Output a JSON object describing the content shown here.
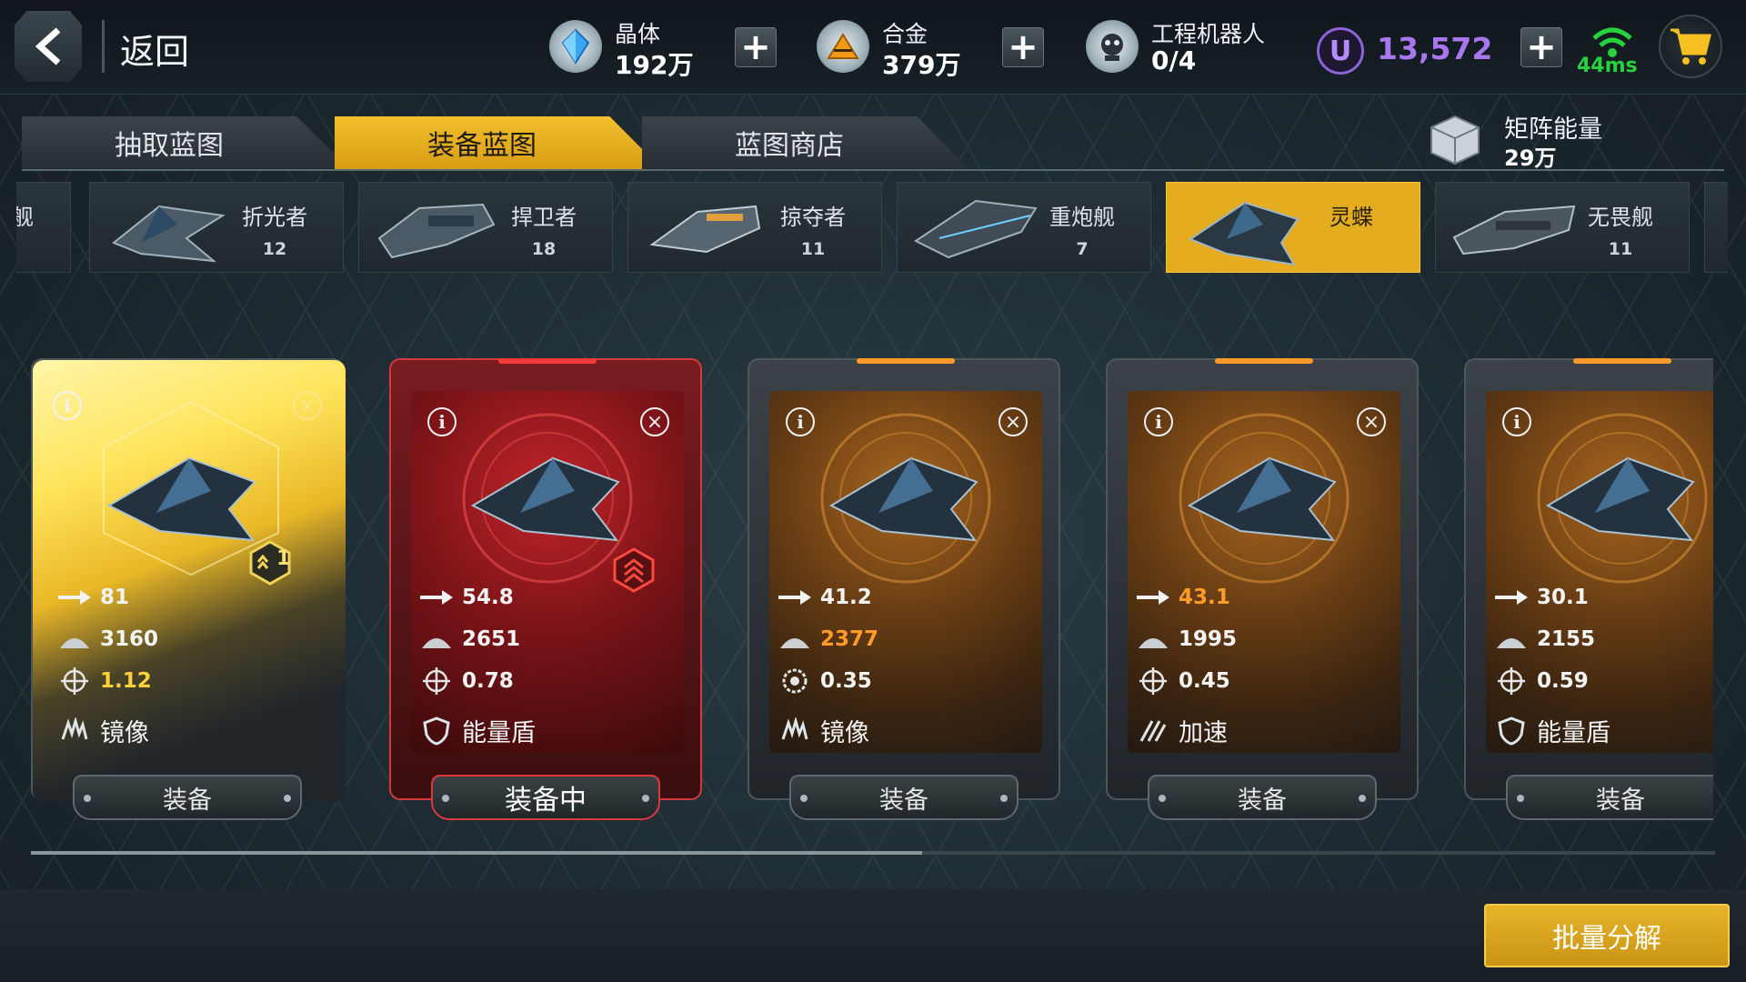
{
  "topbar": {
    "back_label": "返回",
    "resources": [
      {
        "name": "晶体",
        "value": "192万",
        "icon": "crystal-icon"
      },
      {
        "name": "合金",
        "value": "379万",
        "icon": "alloy-icon"
      },
      {
        "name": "工程机器人",
        "value": "0/4",
        "icon": "robot-icon"
      }
    ],
    "currency": {
      "icon_letter": "U",
      "value": "13,572"
    },
    "ping": "44ms"
  },
  "tabs": [
    {
      "label": "抽取蓝图",
      "active": false
    },
    {
      "label": "装备蓝图",
      "active": true
    },
    {
      "label": "蓝图商店",
      "active": false
    }
  ],
  "matrix_energy": {
    "label": "矩阵能量",
    "value": "29万"
  },
  "ships": [
    {
      "name": "舰",
      "count": ""
    },
    {
      "name": "折光者",
      "count": "12"
    },
    {
      "name": "捍卫者",
      "count": "18"
    },
    {
      "name": "掠夺者",
      "count": "11"
    },
    {
      "name": "重炮舰",
      "count": "7"
    },
    {
      "name": "灵蝶",
      "count": "",
      "active": true
    },
    {
      "name": "无畏舰",
      "count": "11"
    }
  ],
  "cards": [
    {
      "style": "yellow",
      "rank": "1",
      "speed": "81",
      "hp": "3160",
      "rate": "1.12",
      "skill": "镜像",
      "button": "装备"
    },
    {
      "style": "red",
      "rank": "",
      "speed": "54.8",
      "hp": "2651",
      "rate": "0.78",
      "skill": "能量盾",
      "button": "装备中"
    },
    {
      "style": "gold",
      "rank": "",
      "speed": "41.2",
      "hp": "2377",
      "rate": "0.35",
      "skill": "镜像",
      "button": "装备"
    },
    {
      "style": "gold",
      "rank": "",
      "speed": "43.1",
      "hp": "1995",
      "rate": "0.45",
      "skill": "加速",
      "button": "装备"
    },
    {
      "style": "gold",
      "rank": "",
      "speed": "30.1",
      "hp": "2155",
      "rate": "0.59",
      "skill": "能量盾",
      "button": "装备"
    }
  ],
  "bulk_button": "批量分解",
  "colors": {
    "accent": "#e4ac1e",
    "equipped_red": "#d23a3e",
    "currency_purple": "#a877f0",
    "ping_green": "#27d33d",
    "highlight_orange": "#ff9c2a"
  }
}
